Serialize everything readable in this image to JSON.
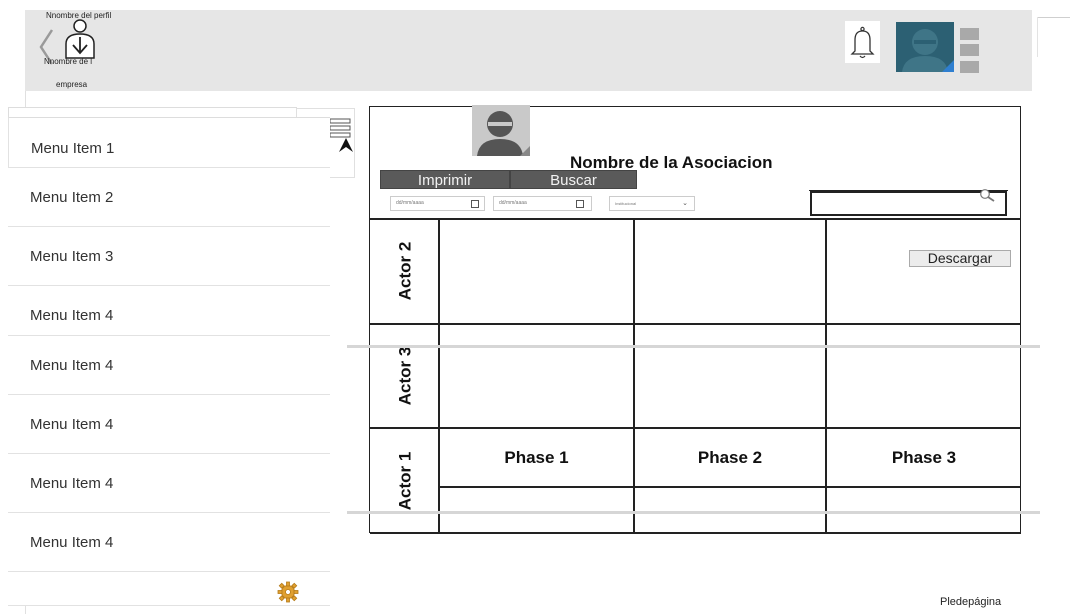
{
  "header": {
    "profile_name": "Nnombre del perfil",
    "company_line1": "Nnombre de l",
    "company_line2": "empresa"
  },
  "sidebar": {
    "items": [
      {
        "label": "Menu Item 1"
      },
      {
        "label": "Menu Item 2"
      },
      {
        "label": "Menu Item 3"
      },
      {
        "label": "Menu Item 4"
      },
      {
        "label": "Menu Item 4"
      },
      {
        "label": "Menu Item 4"
      },
      {
        "label": "Menu Item 4"
      },
      {
        "label": "Menu Item 4"
      }
    ]
  },
  "main": {
    "org_title": "Nombre de la Asociacion",
    "print_label": "Imprimir",
    "search_label": "Buscar",
    "date_from_placeholder": "dd/mm/aaaa",
    "date_to_placeholder": "dd/mm/aaaa",
    "select_value": "Institucional",
    "download_label": "Descargar",
    "actors": [
      "Actor 2",
      "Actor 3",
      "Actor 1"
    ],
    "phases": [
      "Phase 1",
      "Phase 2",
      "Phase 3"
    ]
  },
  "footer": {
    "text": "Pledepágina"
  },
  "colors": {
    "header_bg": "#e6e6e6",
    "avatar_bg": "#2c6073",
    "button_bg": "#5a5a5a"
  }
}
